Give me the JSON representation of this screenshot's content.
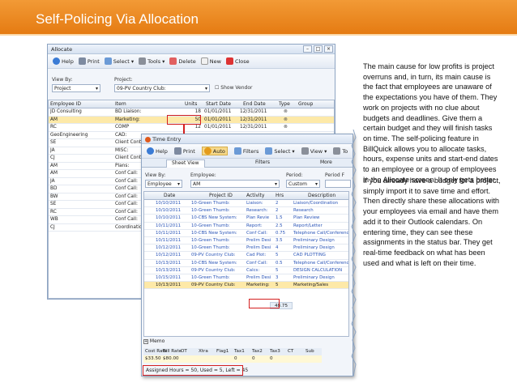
{
  "slide_title": "Self-Policing Via Allocation",
  "allocate": {
    "title": "Allocate",
    "toolbar": [
      "Help",
      "Print",
      "Select",
      "Tools",
      "Delete",
      "New",
      "Close"
    ],
    "view_by_label": "View By:",
    "view_by_value": "Project",
    "project_label": "Project:",
    "project_value": "09-PV Country Club:",
    "show_vendor": "Show Vendor",
    "columns": [
      "Employee ID",
      "Item",
      "Units",
      "Start Date",
      "End Date",
      "Type",
      "Group"
    ],
    "rows": [
      {
        "emp": "JD Consulting",
        "item": "BD Liaison:",
        "units": "18",
        "start": "01/01/2011",
        "end": "12/31/2011"
      },
      {
        "emp": "AM",
        "item": "Marketing:",
        "units": "50",
        "start": "01/01/2011",
        "end": "12/31/2011"
      },
      {
        "emp": "RC",
        "item": "COMP",
        "units": "12",
        "start": "01/01/2011",
        "end": "12/31/2011"
      },
      {
        "emp": "GeoEngineering",
        "item": "CAD:",
        "units": "",
        "start": "",
        "end": ""
      },
      {
        "emp": "SE",
        "item": "Client Cont",
        "units": "",
        "start": "",
        "end": ""
      },
      {
        "emp": "JA",
        "item": "MISC:",
        "units": "",
        "start": "",
        "end": ""
      },
      {
        "emp": "CJ",
        "item": "Client Cont",
        "units": "",
        "start": "",
        "end": ""
      },
      {
        "emp": "AM",
        "item": "Plans:",
        "units": "",
        "start": "",
        "end": ""
      },
      {
        "emp": "AM",
        "item": "Conf Call:",
        "units": "",
        "start": "",
        "end": ""
      },
      {
        "emp": "JA",
        "item": "Conf Call:",
        "units": "",
        "start": "",
        "end": ""
      },
      {
        "emp": "BD",
        "item": "Conf Call:",
        "units": "",
        "start": "",
        "end": ""
      },
      {
        "emp": "BW",
        "item": "Conf Call:",
        "units": "",
        "start": "",
        "end": ""
      },
      {
        "emp": "SE",
        "item": "Conf Call:",
        "units": "",
        "start": "",
        "end": ""
      },
      {
        "emp": "RC",
        "item": "Conf Call:",
        "units": "",
        "start": "",
        "end": ""
      },
      {
        "emp": "WB",
        "item": "Conf Call:",
        "units": "",
        "start": "",
        "end": ""
      },
      {
        "emp": "CJ",
        "item": "Coordination",
        "units": "",
        "start": "",
        "end": ""
      }
    ]
  },
  "time_entry": {
    "title": "Time Entry",
    "toolbar": [
      "Help",
      "Print",
      "Auto",
      "Filters",
      "Select",
      "View",
      "To"
    ],
    "tabs": [
      "Sheet View",
      "Filters",
      "More"
    ],
    "view_by_label": "View By:",
    "view_by_value": "Employee",
    "employee_label": "Employee:",
    "employee_value": "AM",
    "period_label": "Period:",
    "period_value": "Custom",
    "period_from_label": "Period F",
    "columns": [
      "Date",
      "Project ID",
      "Activity",
      "Hrs",
      "Description"
    ],
    "rows": [
      {
        "date": "10/10/2011",
        "project": "10-Green Thumb:",
        "activity": "Liaison:",
        "hrs": "2",
        "desc": "Liaison/Coordination"
      },
      {
        "date": "10/10/2011",
        "project": "10-Green Thumb:",
        "activity": "Research:",
        "hrs": "2",
        "desc": "Research"
      },
      {
        "date": "10/10/2011",
        "project": "10-CBS New System:",
        "activity": "Plan Revie",
        "hrs": "1.5",
        "desc": "Plan Review"
      },
      {
        "date": "10/11/2011",
        "project": "10-Green Thumb:",
        "activity": "Report:",
        "hrs": "2.5",
        "desc": "Report/Letter"
      },
      {
        "date": "10/11/2011",
        "project": "10-CBS New System:",
        "activity": "Conf Call:",
        "hrs": "0.75",
        "desc": "Telephone Call/Conference"
      },
      {
        "date": "10/11/2011",
        "project": "10-Green Thumb:",
        "activity": "Prelim Desi",
        "hrs": "3.5",
        "desc": "Preliminary Design"
      },
      {
        "date": "10/12/2011",
        "project": "10-Green Thumb:",
        "activity": "Prelim Desi",
        "hrs": "4",
        "desc": "Preliminary Design"
      },
      {
        "date": "10/12/2011",
        "project": "09-PV Country Club:",
        "activity": "Cad Plot:",
        "hrs": "5",
        "desc": "CAD PLOTTING"
      },
      {
        "date": "10/13/2011",
        "project": "10-CBS New System:",
        "activity": "Conf Call:",
        "hrs": "0.5",
        "desc": "Telephone Call/Conference"
      },
      {
        "date": "10/13/2011",
        "project": "09-PV Country Club:",
        "activity": "Calcs:",
        "hrs": "5",
        "desc": "DESIGN CALCULATION"
      },
      {
        "date": "10/15/2011",
        "project": "10-Green Thumb:",
        "activity": "Prelim Desi",
        "hrs": "3",
        "desc": "Preliminary Design"
      },
      {
        "date": "10/13/2011",
        "project": "09-PV Country Club:",
        "activity": "Marketing:",
        "hrs": "5",
        "desc": "Marketing/Sales"
      }
    ],
    "total_hours": "48.75",
    "memo_label": "Memo",
    "cost_columns": [
      "Cost Rate",
      "Bill Rate",
      "OT",
      "Xtra",
      "Flag1",
      "Tax1",
      "Tax2",
      "Tax3",
      "CT",
      "Sub"
    ],
    "cost_values": [
      "$33.50",
      "$80.00",
      "",
      "",
      "",
      "0",
      "0",
      "0",
      "",
      ""
    ],
    "status_text": "Assigned Hours = 50, Used = 5, Left = 45"
  },
  "body_text": {
    "p1": "The main cause for low profits is project overruns and, in turn, its main cause is the fact that employees are unaware of the expectations you have of them. They work on projects with no clue about budgets and deadlines. Give them a certain budget and they will finish tasks on time. The self-policing feature in BillQuick allows you to allocate tasks, hours, expense units and start-end dates to an employee or a group of employees in the Allocate screen. It only gets better.",
    "p2": "If you already have a budget for a project, simply import it to save time and effort. Then directly share these allocations with your employees via email and have them add it to their Outlook calendars. On entering time, they can see these assignments in the status bar. They get real-time feedback on what has been used and what is left on their time."
  },
  "colors": {
    "title_bar": "#e98b20",
    "highlight_box": "#d42020",
    "row_highlight": "#fde9a8"
  }
}
